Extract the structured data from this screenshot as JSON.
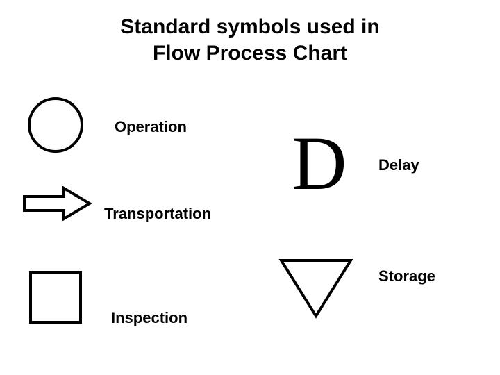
{
  "title_line1": "Standard symbols used in",
  "title_line2": "Flow Process Chart",
  "symbols": {
    "operation": {
      "label": "Operation"
    },
    "transportation": {
      "label": "Transportation"
    },
    "inspection": {
      "label": "Inspection"
    },
    "delay": {
      "label": "Delay",
      "glyph": "D"
    },
    "storage": {
      "label": "Storage"
    }
  }
}
